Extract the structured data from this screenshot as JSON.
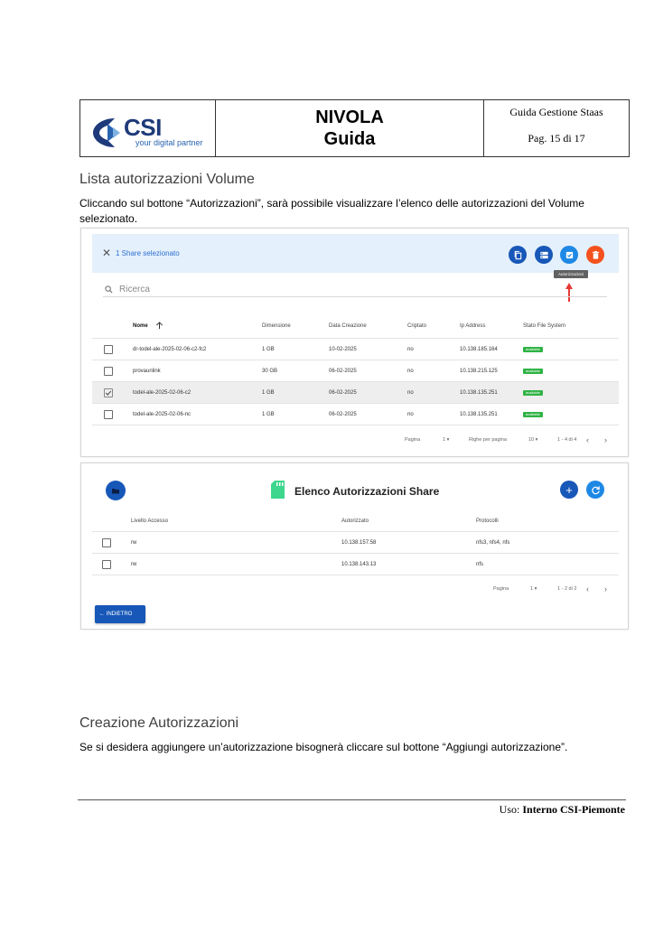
{
  "header": {
    "logo_text": "CSI",
    "logo_tagline": "your digital partner",
    "title_line1": "NIVOLA",
    "title_line2": "Guida",
    "doc_name": "Guida Gestione Staas",
    "page": "Pag. 15 di 17"
  },
  "section1": {
    "heading": "Lista autorizzazioni Volume",
    "text": "Cliccando sul bottone “Autorizzazioni”, sarà possibile visualizzare l’elenco delle autorizzazioni del Volume selezionato."
  },
  "screenshot1": {
    "selection_label": "1 Share selezionato",
    "tooltip": "Autorizzazioni",
    "search_placeholder": "Ricerca",
    "columns": [
      "Nome",
      "Dimensione",
      "Data Creazione",
      "Criptato",
      "Ip Address",
      "Stato File System"
    ],
    "rows": [
      {
        "nome": "dr-todel-ale-2025-02-06-c2-fc2",
        "dimensione": "1 GB",
        "data": "10-02-2025",
        "criptato": "no",
        "ip": "10.138.185.164",
        "stato": "available",
        "checked": false
      },
      {
        "nome": "provaunlink",
        "dimensione": "30 GB",
        "data": "06-02-2025",
        "criptato": "no",
        "ip": "10.138.215.125",
        "stato": "available",
        "checked": false
      },
      {
        "nome": "todel-ale-2025-02-06-c2",
        "dimensione": "1 GB",
        "data": "06-02-2025",
        "criptato": "no",
        "ip": "10.138.135.251",
        "stato": "available",
        "checked": true
      },
      {
        "nome": "todel-ale-2025-02-06-nc",
        "dimensione": "1 GB",
        "data": "06-02-2025",
        "criptato": "no",
        "ip": "10.138.135.251",
        "stato": "available",
        "checked": false
      }
    ],
    "pager": {
      "pagina_label": "Pagina",
      "pagina_value": "1",
      "righe_label": "Righe per pagina",
      "righe_value": "10",
      "range": "1 - 4 di 4"
    },
    "colors": {
      "copy": "#1757b8",
      "storage": "#1757b8",
      "auth": "#1e88e5",
      "delete": "#f4511e",
      "arrow": "#e53935"
    },
    "icons": [
      "close-icon",
      "copy-icon",
      "storage-icon",
      "authorization-icon",
      "delete-icon",
      "search-icon",
      "arrow-up-icon"
    ]
  },
  "screenshot2": {
    "title": "Elenco Autorizzazioni Share",
    "columns": [
      "Livello Accesso",
      "Autorizzato",
      "Protocolli"
    ],
    "rows": [
      {
        "livello": "rw",
        "autorizzato": "10.138.157.58",
        "protocolli": "nfs3, nfs4, nfs"
      },
      {
        "livello": "rw",
        "autorizzato": "10.138.143.13",
        "protocolli": "nfs"
      }
    ],
    "pager": {
      "pagina_label": "Pagina",
      "pagina_value": "1",
      "range": "1 - 2 di 2"
    },
    "back_button": "INDIETRO"
  },
  "section2": {
    "heading": "Creazione Autorizzazioni",
    "text": "Se si desidera aggiungere un’autorizzazione bisognerà cliccare sul bottone “Aggiungi autorizzazione”."
  },
  "footer": {
    "label": "Uso:",
    "value": "Interno CSI-Piemonte"
  }
}
